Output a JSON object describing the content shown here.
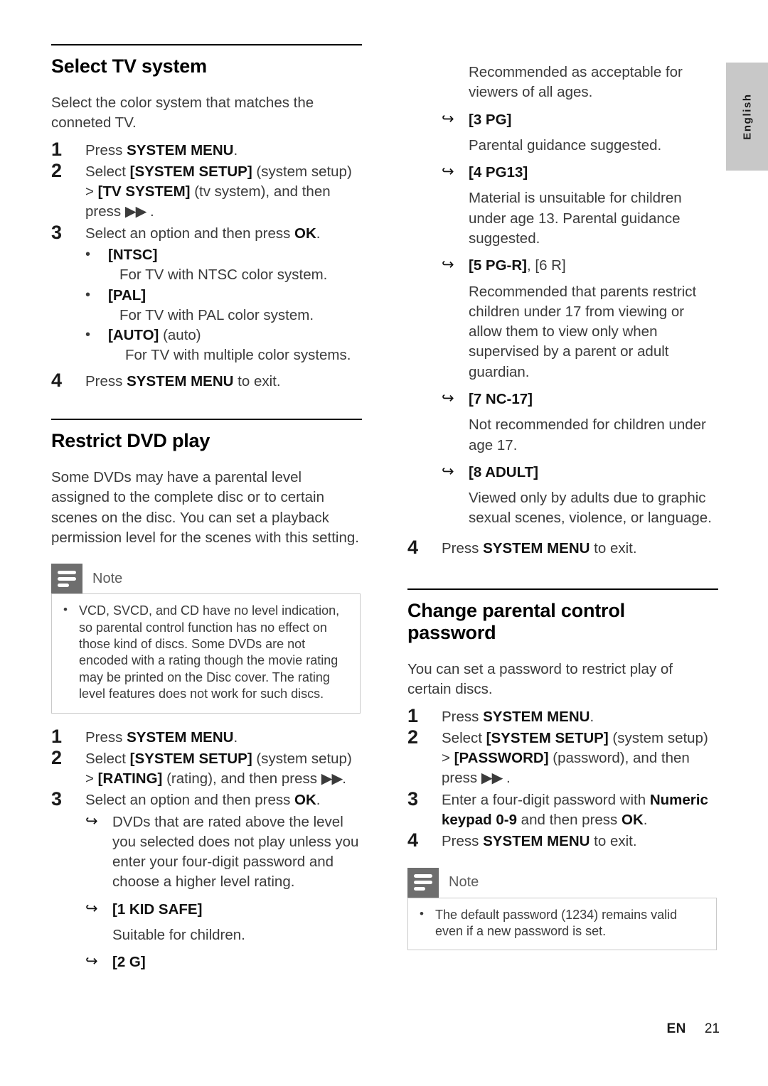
{
  "page": {
    "language_tab": "English",
    "footer_locale": "EN",
    "footer_page_number": "21"
  },
  "left_column": {
    "section_tv": {
      "title": "Select TV system",
      "intro": "Select the color system that matches the conneted TV.",
      "steps": [
        {
          "num": "1",
          "text_before": "Press ",
          "bold": "SYSTEM MENU",
          "text_after": "."
        },
        {
          "num": "2",
          "line1_before": "Select ",
          "line1_bold": "[SYSTEM SETUP]",
          "line1_after": " (system setup)",
          "line2_before": "> ",
          "line2_bold": "[TV SYSTEM]",
          "line2_after": " (tv system), and then",
          "line3_before": "press ",
          "line3_icon": "▶▶",
          "line3_after": " ."
        },
        {
          "num": "3",
          "text_before": "Select an option and then press ",
          "bold": "OK",
          "text_after": "."
        },
        {
          "num": "4",
          "text_before": "Press ",
          "bold": "SYSTEM MENU",
          "text_after": " to exit."
        }
      ],
      "options": [
        {
          "label": "[NTSC]",
          "suffix": "",
          "desc": "For TV with NTSC color system."
        },
        {
          "label": "[PAL]",
          "suffix": "",
          "desc": "For TV with PAL color system."
        },
        {
          "label": "[AUTO]",
          "suffix": " (auto)",
          "desc": "For TV with multiple color systems."
        }
      ]
    },
    "section_restrict": {
      "title": "Restrict DVD play",
      "intro": "Some DVDs may have a parental level assigned to the complete disc or to certain scenes on the disc. You can set a playback permission level for the scenes with this setting.",
      "note": {
        "title": "Note",
        "bullets": [
          "VCD, SVCD, and CD have no level indication, so parental control function has no effect on those kind of discs. Some DVDs are not encoded with a rating though the movie rating may be printed on the Disc cover. The rating level features does not work for such discs."
        ]
      },
      "steps": [
        {
          "num": "1",
          "text_before": "Press ",
          "bold": "SYSTEM MENU",
          "text_after": "."
        },
        {
          "num": "2",
          "line1_before": "Select ",
          "line1_bold": "[SYSTEM SETUP]",
          "line1_after": " (system setup)",
          "line2_before": "> ",
          "line2_bold": "[RATING]",
          "line2_after": " (rating), and then press ",
          "line2_icon": "▶▶",
          "line2_end": "."
        },
        {
          "num": "3",
          "text_before": "Select an option and then press ",
          "bold": "OK",
          "text_after": "."
        }
      ],
      "result_note": "DVDs that are rated above the level you selected does not play unless you enter your four-digit password and choose a higher level rating.",
      "ratings": [
        {
          "tag": "[1 KID SAFE]",
          "desc": "Suitable for children."
        },
        {
          "tag": "[2 G]",
          "desc": ""
        }
      ]
    }
  },
  "right_column": {
    "continued_desc": "Recommended as acceptable for viewers of all ages.",
    "ratings": [
      {
        "tag": "[3 PG]",
        "desc": "Parental guidance suggested."
      },
      {
        "tag": "[4 PG13]",
        "desc": "Material is unsuitable for children under age 13. Parental guidance suggested."
      },
      {
        "tag": "[5 PG-R]",
        "tag_suffix": ", [6 R]",
        "desc": "Recommended that parents restrict children under 17 from viewing or allow them to view only when supervised by a parent or adult guardian."
      },
      {
        "tag": "[7 NC-17]",
        "desc": "Not recommended for children under age 17."
      },
      {
        "tag": "[8 ADULT]",
        "desc": "Viewed only by adults due to graphic sexual scenes, violence, or language."
      }
    ],
    "final_step": {
      "num": "4",
      "text_before": "Press ",
      "bold": "SYSTEM MENU",
      "text_after": " to exit."
    },
    "section_password": {
      "title": "Change parental control password",
      "intro": "You can set a password to restrict play of certain discs.",
      "steps": [
        {
          "num": "1",
          "text_before": "Press ",
          "bold": "SYSTEM MENU",
          "text_after": "."
        },
        {
          "num": "2",
          "line1_before": "Select ",
          "line1_bold": "[SYSTEM SETUP]",
          "line1_after": " (system setup)",
          "line2_before": "> ",
          "line2_bold": "[PASSWORD]",
          "line2_after": " (password), and then",
          "line3_before": "press ",
          "line3_icon": "▶▶",
          "line3_after": " ."
        },
        {
          "num": "3",
          "text_before": "Enter a four-digit password with ",
          "bold": "Numeric keypad 0-9",
          "text_mid": " and then press ",
          "bold2": "OK",
          "text_after": "."
        },
        {
          "num": "4",
          "text_before": "Press ",
          "bold": "SYSTEM MENU",
          "text_after": " to exit."
        }
      ],
      "note": {
        "title": "Note",
        "bullets": [
          "The default password (1234) remains valid even if a new password is set."
        ]
      }
    }
  }
}
